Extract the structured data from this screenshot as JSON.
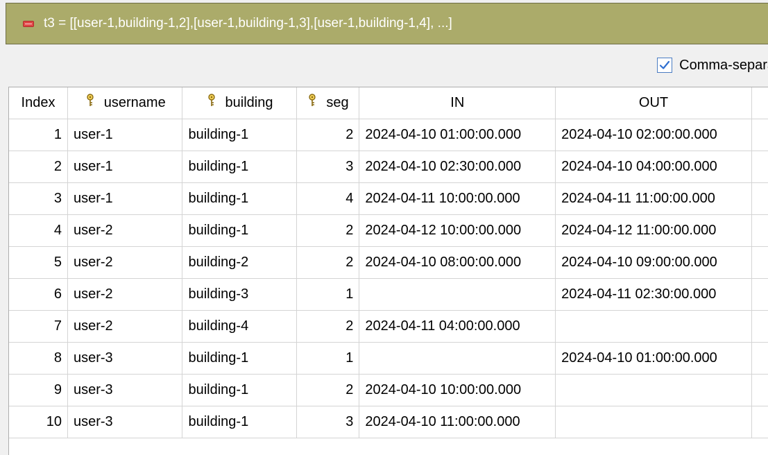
{
  "header": {
    "icon": "minus-icon",
    "title": "t3 = [[user-1,building-1,2],[user-1,building-1,3],[user-1,building-1,4], ...]"
  },
  "options": {
    "comma_checkbox_label": "Comma-separa",
    "comma_checked": true
  },
  "table": {
    "columns": [
      {
        "label": "Index",
        "key_icon": false
      },
      {
        "label": "username",
        "key_icon": true
      },
      {
        "label": "building",
        "key_icon": true
      },
      {
        "label": "seg",
        "key_icon": true
      },
      {
        "label": "IN",
        "key_icon": false
      },
      {
        "label": "OUT",
        "key_icon": false
      }
    ],
    "rows": [
      {
        "index": "1",
        "username": "user-1",
        "building": "building-1",
        "seg": "2",
        "in": "2024-04-10 01:00:00.000",
        "out": "2024-04-10 02:00:00.000"
      },
      {
        "index": "2",
        "username": "user-1",
        "building": "building-1",
        "seg": "3",
        "in": "2024-04-10 02:30:00.000",
        "out": "2024-04-10 04:00:00.000"
      },
      {
        "index": "3",
        "username": "user-1",
        "building": "building-1",
        "seg": "4",
        "in": "2024-04-11 10:00:00.000",
        "out": "2024-04-11 11:00:00.000"
      },
      {
        "index": "4",
        "username": "user-2",
        "building": "building-1",
        "seg": "2",
        "in": "2024-04-12 10:00:00.000",
        "out": "2024-04-12 11:00:00.000"
      },
      {
        "index": "5",
        "username": "user-2",
        "building": "building-2",
        "seg": "2",
        "in": "2024-04-10 08:00:00.000",
        "out": "2024-04-10 09:00:00.000"
      },
      {
        "index": "6",
        "username": "user-2",
        "building": "building-3",
        "seg": "1",
        "in": "",
        "out": "2024-04-11 02:30:00.000"
      },
      {
        "index": "7",
        "username": "user-2",
        "building": "building-4",
        "seg": "2",
        "in": "2024-04-11 04:00:00.000",
        "out": ""
      },
      {
        "index": "8",
        "username": "user-3",
        "building": "building-1",
        "seg": "1",
        "in": "",
        "out": "2024-04-10 01:00:00.000"
      },
      {
        "index": "9",
        "username": "user-3",
        "building": "building-1",
        "seg": "2",
        "in": "2024-04-10 10:00:00.000",
        "out": ""
      },
      {
        "index": "10",
        "username": "user-3",
        "building": "building-1",
        "seg": "3",
        "in": "2024-04-10 11:00:00.000",
        "out": ""
      }
    ]
  }
}
